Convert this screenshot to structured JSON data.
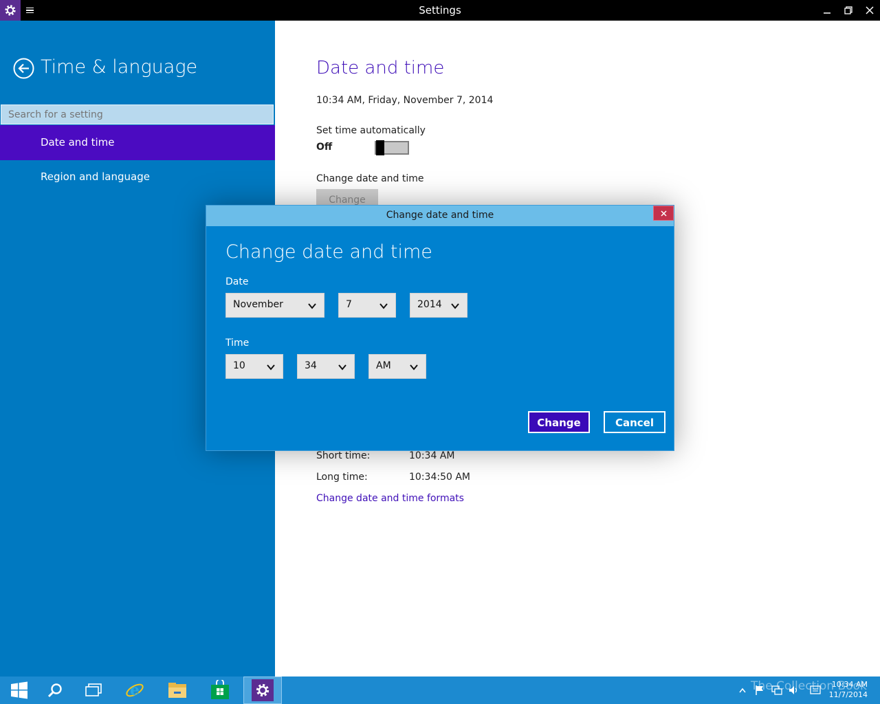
{
  "window": {
    "title": "Settings"
  },
  "sidebar": {
    "title": "Time & language",
    "search_placeholder": "Search for a setting",
    "items": [
      {
        "label": "Date and time",
        "active": true
      },
      {
        "label": "Region and language",
        "active": false
      }
    ]
  },
  "main": {
    "title": "Date and time",
    "current_datetime": "10:34 AM, Friday, November 7, 2014",
    "set_time_auto_label": "Set time automatically",
    "toggle_state": "Off",
    "change_section_label": "Change date and time",
    "change_button": "Change",
    "formats": [
      {
        "label": "Short time:",
        "value": "10:34 AM"
      },
      {
        "label": "Long time:",
        "value": "10:34:50 AM"
      }
    ],
    "formats_link": "Change date and time formats"
  },
  "dialog": {
    "window_title": "Change date and time",
    "heading": "Change date and time",
    "date_label": "Date",
    "month": "November",
    "day": "7",
    "year": "2014",
    "time_label": "Time",
    "hour": "10",
    "minute": "34",
    "ampm": "AM",
    "change_button": "Change",
    "cancel_button": "Cancel"
  },
  "taskbar": {
    "clock_time": "10:34 AM",
    "clock_date": "11/7/2014",
    "watermark": "The Collection Book"
  },
  "colors": {
    "sidebar": "#0079c1",
    "accent": "#4b0bc1",
    "dialog": "#0081cf",
    "dialog_titlebar": "#6bbde9",
    "taskbar": "#1c8ad0"
  }
}
